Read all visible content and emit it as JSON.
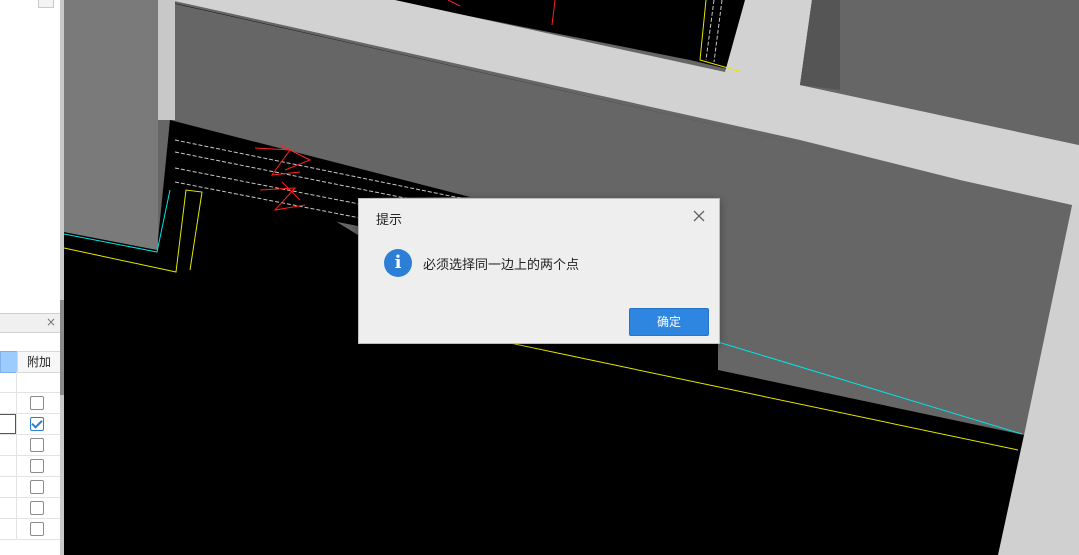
{
  "panel": {
    "close_glyph": "×",
    "table": {
      "attach_header": "附加",
      "rows": [
        {
          "checked": false
        },
        {
          "checked": false
        },
        {
          "checked": true
        },
        {
          "checked": false
        },
        {
          "checked": false
        },
        {
          "checked": false
        },
        {
          "checked": false
        },
        {
          "checked": false
        }
      ]
    }
  },
  "canvas": {
    "colors": {
      "background": "#000000",
      "wall_dark": "#666666",
      "wall_light": "#d0d0d0",
      "line_cyan": "#00e5e5",
      "line_yellow": "#e6e600",
      "annotation_red": "#ff2020"
    }
  },
  "dialog": {
    "title": "提示",
    "icon": "info-icon",
    "message": "必须选择同一边上的两个点",
    "ok_label": "确定",
    "close_icon": "close-icon"
  }
}
